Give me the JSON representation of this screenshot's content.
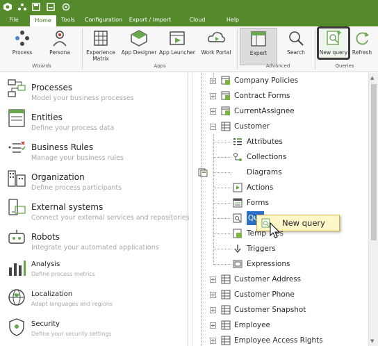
{
  "tabs": [
    "File",
    "Home",
    "Tools",
    "Configuration",
    "Export / Import",
    "Cloud Services",
    "Help"
  ],
  "ribbon": {
    "buttons": {
      "process": "Process",
      "persona": "Persona",
      "experience_matrix": "Experience Matrix",
      "app_designer": "App Designer",
      "app_launcher": "App Launcher",
      "work_portal": "Work Portal",
      "expert": "Expert",
      "search": "Search",
      "new_query": "New query",
      "refresh": "Refresh"
    },
    "groups": {
      "wizards": "Wizards",
      "apps": "Apps",
      "advanced": "Advanced",
      "queries": "Queries"
    }
  },
  "nav": [
    {
      "title": "Processes",
      "subtitle": "Model your business processes"
    },
    {
      "title": "Entities",
      "subtitle": "Define your process data"
    },
    {
      "title": "Business Rules",
      "subtitle": "Manage your business rules"
    },
    {
      "title": "Organization",
      "subtitle": "Define process participants"
    },
    {
      "title": "External systems",
      "subtitle": "Connect your external services and repositories"
    },
    {
      "title": "Robots",
      "subtitle": "Integrate your automated applications"
    },
    {
      "title": "Analysis",
      "subtitle": "Define process metrics"
    },
    {
      "title": "Localization",
      "subtitle": "Adapt languages and regions"
    },
    {
      "title": "Security",
      "subtitle": "Define your security settings"
    }
  ],
  "tree": {
    "top": [
      "Company Policies",
      "Contract Forms",
      "CurrentAssignee",
      "Customer"
    ],
    "children": [
      "Attributes",
      "Collections",
      "Diagrams",
      "Actions",
      "Forms",
      "Queries",
      "Templates",
      "Triggers",
      "Expressions"
    ],
    "selected_fragment": "Que",
    "templates_fragment": "Temp",
    "templates_tail": "es",
    "after": [
      "Customer Address",
      "Customer Phone",
      "Customer Snapshot",
      "Employee",
      "Employee Access Rights"
    ]
  },
  "context_menu": {
    "label": "New query"
  },
  "colors": {
    "brand_green": "#548a2c",
    "selection_blue": "#2c6fc7",
    "popup_yellow": "#fff7c7"
  }
}
